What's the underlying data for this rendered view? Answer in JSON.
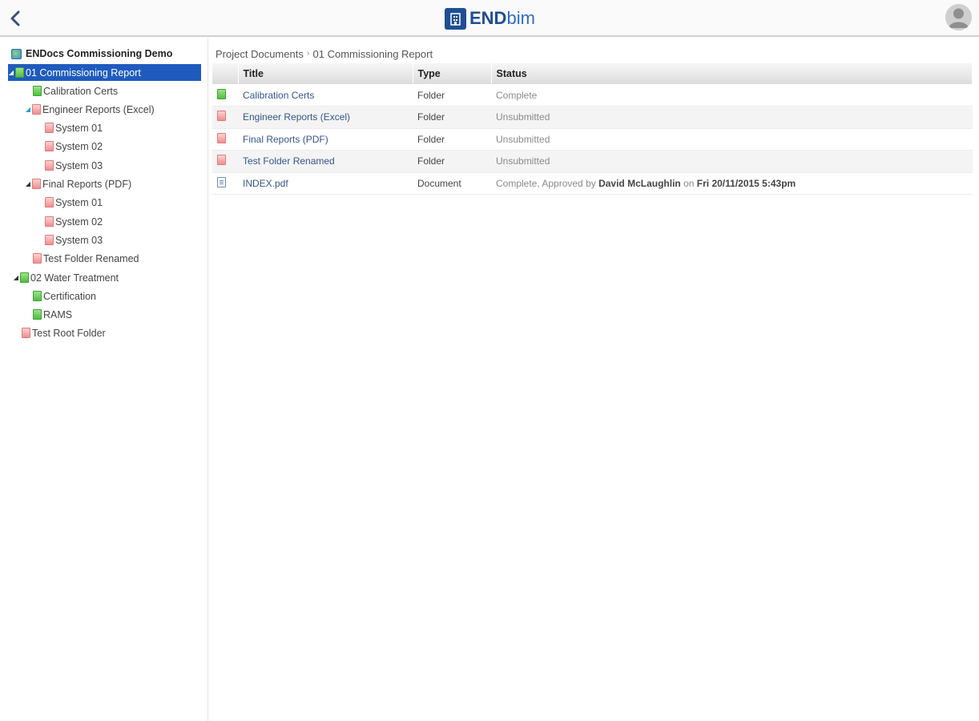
{
  "header": {
    "logo_end": "END",
    "logo_bim": "bim",
    "back_icon": "chevron-left-icon",
    "avatar_icon": "user-avatar-icon"
  },
  "colors": {
    "brand": "#1f4e92",
    "selection": "#1f5bbf",
    "folder_complete": "#4fc03f",
    "folder_unsubmitted": "#f08f8f"
  },
  "sidebar": {
    "root": "ENDocs Commissioning Demo",
    "items": [
      {
        "label": "01 Commissioning Report",
        "state": "complete",
        "selected": true
      },
      {
        "label": "Calibration Certs",
        "state": "complete"
      },
      {
        "label": "Engineer Reports (Excel)",
        "state": "unsubmitted"
      },
      {
        "label": "System 01",
        "state": "unsubmitted"
      },
      {
        "label": "System 02",
        "state": "unsubmitted"
      },
      {
        "label": "System 03",
        "state": "unsubmitted"
      },
      {
        "label": "Final Reports (PDF)",
        "state": "unsubmitted"
      },
      {
        "label": "System 01",
        "state": "unsubmitted"
      },
      {
        "label": "System 02",
        "state": "unsubmitted"
      },
      {
        "label": "System 03",
        "state": "unsubmitted"
      },
      {
        "label": "Test Folder Renamed",
        "state": "unsubmitted"
      },
      {
        "label": "02 Water Treatment",
        "state": "complete"
      },
      {
        "label": "Certification",
        "state": "document"
      },
      {
        "label": "RAMS",
        "state": "complete"
      },
      {
        "label": "Test Root Folder",
        "state": "unsubmitted"
      }
    ]
  },
  "breadcrumb": {
    "root": "Project Documents",
    "separator": "›",
    "current": "01 Commissioning Report"
  },
  "table": {
    "columns": [
      "Title",
      "Type",
      "Status"
    ],
    "rows": [
      {
        "title": "Calibration Certs",
        "type": "Folder",
        "status": "Complete",
        "icon": "folder-green-icon"
      },
      {
        "title": "Engineer Reports (Excel)",
        "type": "Folder",
        "status": "Unsubmitted",
        "icon": "folder-red-icon"
      },
      {
        "title": "Final Reports (PDF)",
        "type": "Folder",
        "status": "Unsubmitted",
        "icon": "folder-red-icon"
      },
      {
        "title": "Test Folder Renamed",
        "type": "Folder",
        "status": "Unsubmitted",
        "icon": "folder-red-icon"
      },
      {
        "title": "INDEX.pdf",
        "type": "Document",
        "status_prefix": "Complete, Approved by ",
        "status_user": "David McLaughlin",
        "status_mid": " on ",
        "status_date": "Fri 20/11/2015 5:43pm",
        "icon": "document-icon"
      }
    ]
  }
}
